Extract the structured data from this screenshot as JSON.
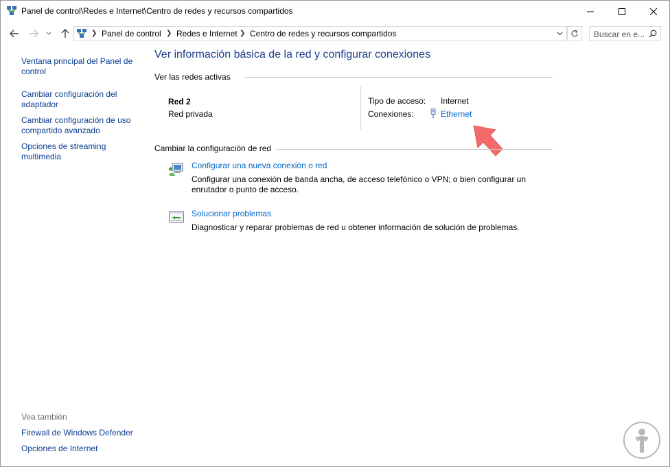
{
  "window": {
    "title": "Panel de control\\Redes e Internet\\Centro de redes y recursos compartidos",
    "controls": {
      "minimize": "minimize",
      "maximize": "maximize",
      "close": "close"
    }
  },
  "address": {
    "breadcrumbs": [
      "Panel de control",
      "Redes e Internet",
      "Centro de redes y recursos compartidos"
    ],
    "search_placeholder": "Buscar en e..."
  },
  "sidebar": {
    "links": [
      "Ventana principal del Panel de control",
      "Cambiar configuración del adaptador",
      "Cambiar configuración de uso compartido avanzado",
      "Opciones de streaming multimedia"
    ],
    "see_also_label": "Vea también",
    "see_also": [
      "Firewall de Windows Defender",
      "Opciones de Internet"
    ]
  },
  "main": {
    "title": "Ver información básica de la red y configurar conexiones",
    "active_networks": {
      "heading": "Ver las redes activas",
      "network_name": "Red  2",
      "network_category": "Red privada",
      "access_type_label": "Tipo de acceso:",
      "access_type_value": "Internet",
      "connections_label": "Conexiones:",
      "connection_link": "Ethernet"
    },
    "change_settings": {
      "heading": "Cambiar la configuración de red",
      "tasks": [
        {
          "title": "Configurar una nueva conexión o red",
          "description": "Configurar una conexión de banda ancha, de acceso telefónico o VPN; o bien configurar un enrutador o punto de acceso."
        },
        {
          "title": "Solucionar problemas",
          "description": "Diagnosticar y reparar problemas de red u obtener información de solución de problemas."
        }
      ]
    }
  },
  "colors": {
    "link": "#0066cc",
    "sidebar_link": "#0b3d91",
    "title": "#1e3f8a",
    "annotation_arrow": "#f26b6b"
  }
}
